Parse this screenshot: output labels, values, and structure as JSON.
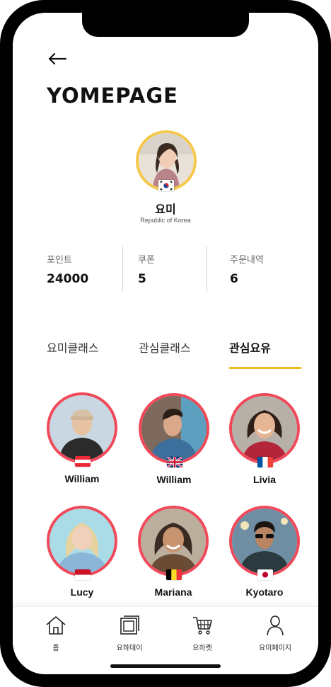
{
  "page": {
    "title": "YOMEPAGE"
  },
  "profile": {
    "name": "요미",
    "country": "Republic of Korea",
    "flag_icon": "south-korea-flag-icon"
  },
  "stats": [
    {
      "label": "포인트",
      "value": "24000"
    },
    {
      "label": "쿠폰",
      "value": "5"
    },
    {
      "label": "주문내역",
      "value": "6"
    }
  ],
  "tabs": [
    {
      "label": "요미클래스",
      "active": false
    },
    {
      "label": "관심클래스",
      "active": false
    },
    {
      "label": "관심요유",
      "active": true
    }
  ],
  "friends": [
    {
      "name": "William",
      "flag_icon": "austria-flag-icon"
    },
    {
      "name": "William",
      "flag_icon": "uk-flag-icon"
    },
    {
      "name": "Livia",
      "flag_icon": "france-flag-icon"
    },
    {
      "name": "Lucy",
      "flag_icon": "indonesia-flag-icon"
    },
    {
      "name": "Mariana",
      "flag_icon": "belgium-flag-icon"
    },
    {
      "name": "Kyotaro",
      "flag_icon": "japan-flag-icon"
    }
  ],
  "bottom_nav": [
    {
      "label": "홈",
      "icon": "home-icon"
    },
    {
      "label": "요하데이",
      "icon": "photo-frame-icon"
    },
    {
      "label": "요하켓",
      "icon": "cart-icon"
    },
    {
      "label": "요미페이지",
      "icon": "person-icon"
    }
  ],
  "colors": {
    "accent": "#f5b922",
    "avatar_ring": "#f04a5a",
    "profile_ring": "#f5c84c"
  }
}
